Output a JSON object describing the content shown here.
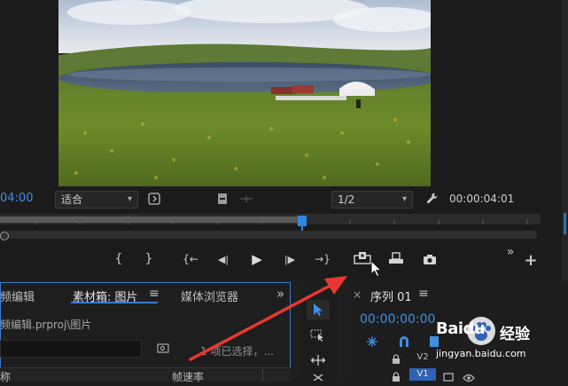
{
  "program_monitor": {
    "timecode_left": "04:00",
    "fit_label": "适合",
    "resolution_label": "1/2",
    "timecode_right": "00:00:04:01"
  },
  "transport": {
    "mark_in": "{",
    "mark_out": "}",
    "go_to_in": "{←",
    "step_back": "◀|",
    "play": "▶",
    "step_forward": "|▶",
    "go_to_out": "→}",
    "more": "»",
    "add": "+"
  },
  "project_panel": {
    "tab_edit_partial": "频编辑",
    "tab_bin": "素材箱: 图片",
    "tab_menu": "≡",
    "tab_media_browser": "媒体浏览器",
    "tab_more": "»",
    "path_text": "频编辑.prproj\\图片",
    "selection_status": "1 项已选择，...",
    "col_name_partial": "称",
    "col_frame_rate": "帧速率"
  },
  "timeline": {
    "close_icon": "×",
    "sequence_tab": "序列 01",
    "tab_menu": "≡",
    "timecode": "00:00:00:00",
    "track_v2": "V2",
    "track_v1": "V1"
  },
  "watermark": {
    "brand": "Baidu",
    "brand_cn": "经验",
    "url": "jingyan.baidu.com"
  },
  "colors": {
    "accent_blue": "#3f8fe6",
    "panel_border": "#3d7bd1",
    "annotation_red": "#e8382f",
    "track_v1_blue": "#2f62b4"
  }
}
